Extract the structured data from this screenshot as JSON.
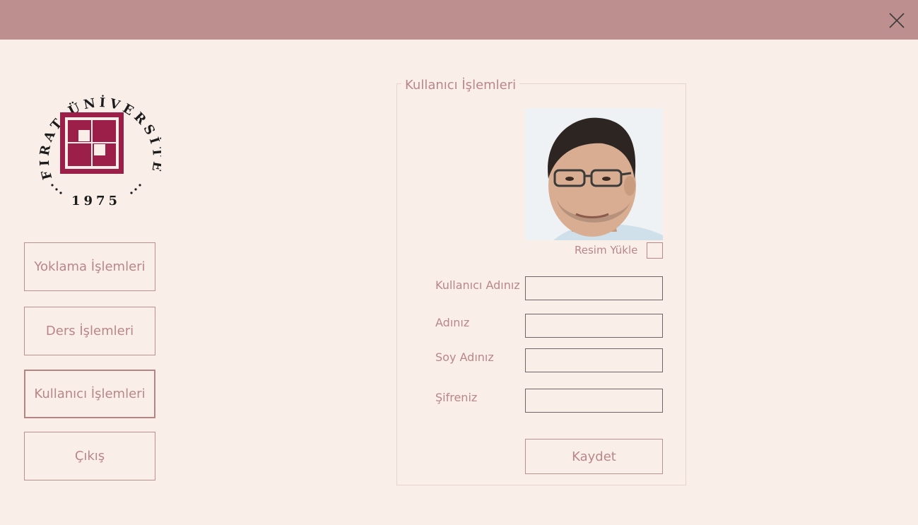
{
  "header": {
    "close_icon": "close-icon"
  },
  "logo": {
    "arc_text": "FIRAT ÜNİVERSİTESİ",
    "year": "1975",
    "brand_color": "#9b1f48"
  },
  "sidebar": {
    "items": [
      {
        "label": "Yoklama İşlemleri"
      },
      {
        "label": "Ders İşlemleri"
      },
      {
        "label": "Kullanıcı İşlemleri",
        "active": true
      },
      {
        "label": "Çıkış"
      }
    ]
  },
  "form": {
    "group_title": "Kullanıcı İşlemleri",
    "upload_label": "Resim Yükle",
    "fields": [
      {
        "label": "Kullanıcı Adınız",
        "value": ""
      },
      {
        "label": "Adınız",
        "value": ""
      },
      {
        "label": "Soy Adınız",
        "value": ""
      },
      {
        "label": "Şifreniz",
        "value": ""
      }
    ],
    "save_label": "Kaydet"
  },
  "colors": {
    "topbar": "#bd8f8e",
    "background": "#f9efe8",
    "text": "#b9868a"
  }
}
